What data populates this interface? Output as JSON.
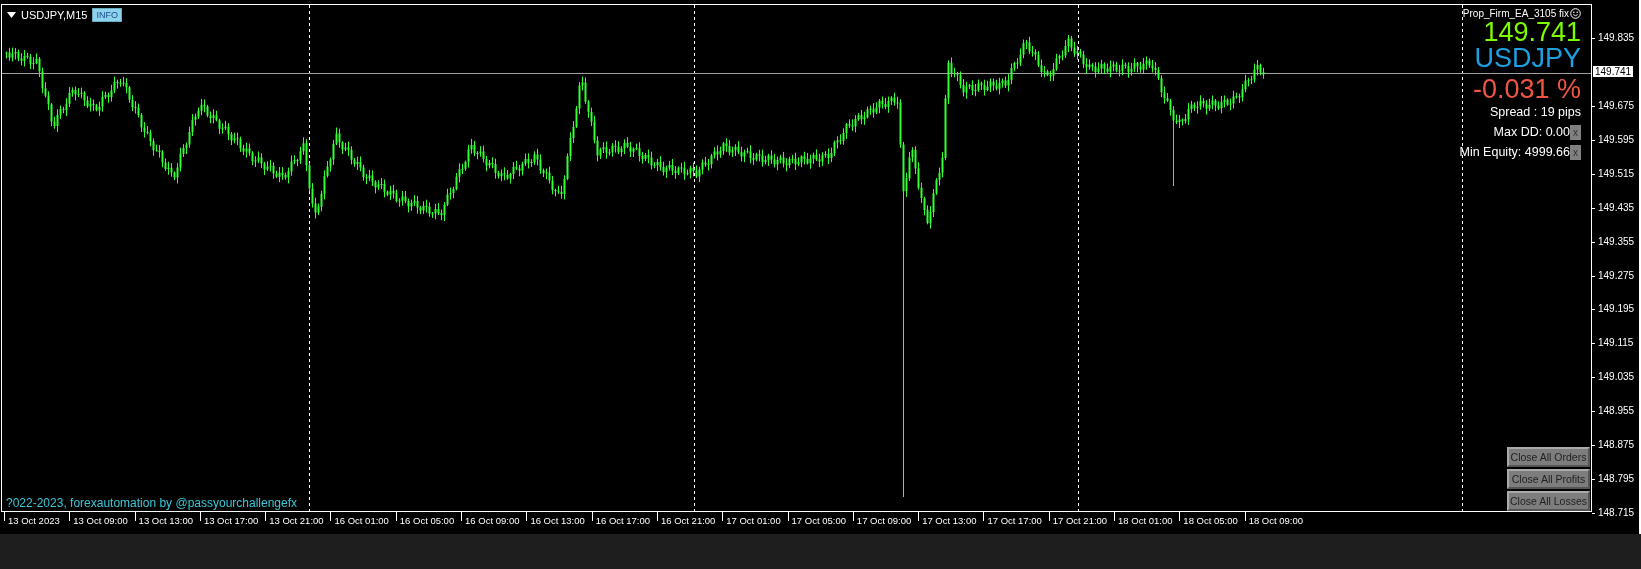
{
  "chart": {
    "symbol": "USDJPY,M15",
    "badge": "INFO"
  },
  "panel": {
    "ea_name": "Prop_Firm_EA_3105 fix",
    "price": "149.741",
    "symbol": "USDJPY",
    "change": "-0.031 %",
    "spread": "Spread : 19 pips",
    "stats": [
      {
        "label": "Max DD: 0.00",
        "button": "x"
      },
      {
        "label": "Min Equity: 4999.66",
        "button": "x"
      }
    ]
  },
  "buttons": [
    "Close All Orders",
    "Close All Profits",
    "Close All Losses"
  ],
  "copyright": "?022-2023, forexautomation by @passyourchallengefx",
  "price_axis": {
    "current": "149.741",
    "ticks": [
      "149.835",
      "149.675",
      "149.595",
      "149.515",
      "149.435",
      "149.355",
      "149.275",
      "149.195",
      "149.115",
      "149.035",
      "148.955",
      "148.875",
      "148.795",
      "148.715"
    ]
  },
  "time_axis": [
    "13 Oct 2023",
    "13 Oct 09:00",
    "13 Oct 13:00",
    "13 Oct 17:00",
    "13 Oct 21:00",
    "16 Oct 01:00",
    "16 Oct 05:00",
    "16 Oct 09:00",
    "16 Oct 13:00",
    "16 Oct 17:00",
    "16 Oct 21:00",
    "17 Oct 01:00",
    "17 Oct 05:00",
    "17 Oct 09:00",
    "17 Oct 13:00",
    "17 Oct 17:00",
    "17 Oct 21:00",
    "18 Oct 01:00",
    "18 Oct 05:00",
    "18 Oct 09:00"
  ]
}
